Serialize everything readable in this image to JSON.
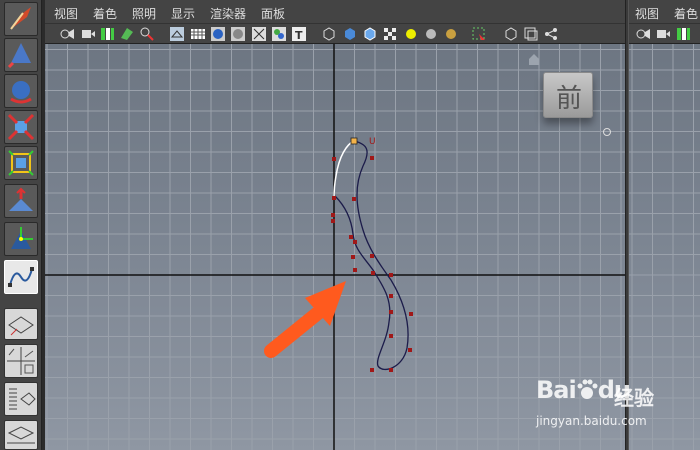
{
  "menu": {
    "items": [
      "视图",
      "着色",
      "照明",
      "显示",
      "渲染器",
      "面板"
    ],
    "secondary": [
      "视图",
      "着色"
    ]
  },
  "viewport": {
    "view_label": "前",
    "highlight_color": "#ffffff",
    "curve_color": "#1c1c4a",
    "cv_color": "#a01818",
    "arrow_color": "#ff5a1e"
  },
  "curve": {
    "start_marker": "U"
  },
  "icons": {
    "toolbox": [
      "select-tool-icon",
      "lasso-tool-icon",
      "paint-select-icon",
      "move-tool-icon",
      "rotate-tool-icon",
      "scale-tool-icon",
      "universal-manipulator-icon",
      "soft-modify-icon",
      "show-manipulator-icon",
      "curve-tool-icon"
    ],
    "layouts": [
      "single-pane-layout-icon",
      "four-pane-layout-icon",
      "outliner-persp-layout-icon",
      "graph-persp-layout-icon"
    ]
  },
  "watermark": {
    "brand": "Bai",
    "brand_suffix": "du",
    "cn": "经验",
    "url": "jingyan.baidu.com"
  }
}
